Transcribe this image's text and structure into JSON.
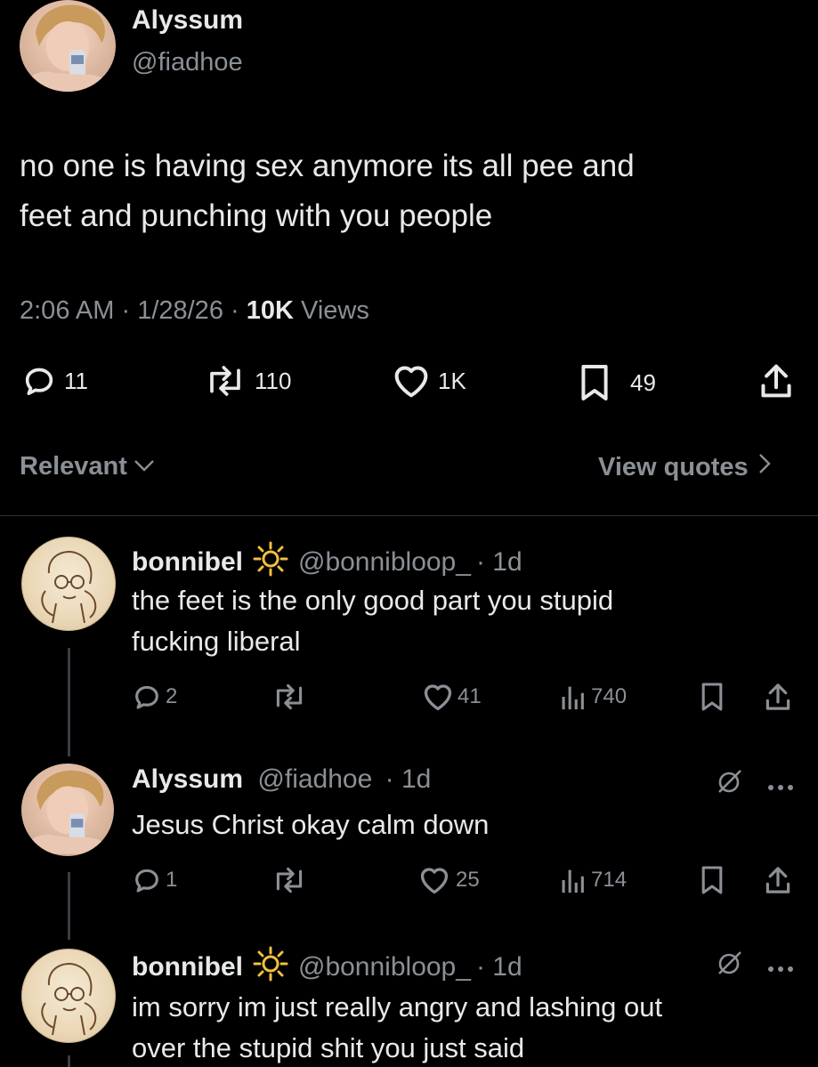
{
  "main_tweet": {
    "display_name": "Alyssum",
    "handle": "@fiadhoe",
    "text_line1": "no one is having sex anymore its all pee and",
    "text_line2": "feet and punching with you people",
    "time": "2:06 AM",
    "date": "1/28/26",
    "views_count": "10K",
    "views_label": "Views",
    "actions": {
      "replies": "11",
      "reposts": "110",
      "likes": "1K",
      "bookmarks": "49"
    }
  },
  "sort": {
    "label": "Relevant",
    "view_quotes": "View quotes"
  },
  "replies": [
    {
      "display_name": "bonnibel",
      "emoji": "☼",
      "handle": "@bonnibloop_",
      "age": "· 1d",
      "line1": "the feet is the only good part you stupid",
      "line2": "fucking liberal",
      "replies": "2",
      "likes": "41",
      "views": "740"
    },
    {
      "display_name": "Alyssum",
      "handle": "@fiadhoe",
      "age": "· 1d",
      "line1": "Jesus Christ okay calm down",
      "replies": "1",
      "likes": "25",
      "views": "714"
    },
    {
      "display_name": "bonnibel",
      "emoji": "☼",
      "handle": "@bonnibloop_",
      "age": "· 1d",
      "line1": "im sorry im just really angry and lashing out",
      "line2": "over the stupid shit you just said"
    }
  ],
  "colors": {
    "background": "#000000",
    "text": "#e7e9ea",
    "secondary": "#8b9096",
    "divider": "#2f3336"
  }
}
